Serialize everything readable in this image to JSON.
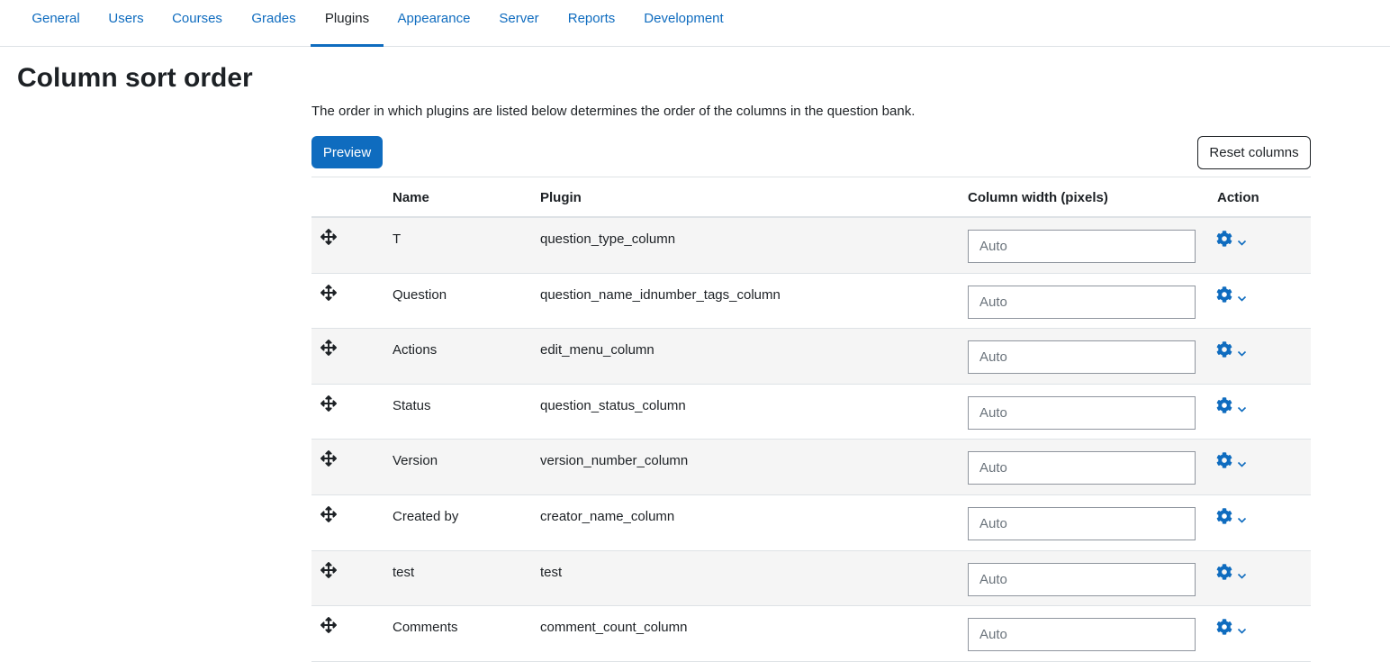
{
  "nav": {
    "tabs": [
      {
        "label": "General"
      },
      {
        "label": "Users"
      },
      {
        "label": "Courses"
      },
      {
        "label": "Grades"
      },
      {
        "label": "Plugins",
        "active": true
      },
      {
        "label": "Appearance"
      },
      {
        "label": "Server"
      },
      {
        "label": "Reports"
      },
      {
        "label": "Development"
      }
    ]
  },
  "page": {
    "title": "Column sort order",
    "intro": "The order in which plugins are listed below determines the order of the columns in the question bank."
  },
  "buttons": {
    "preview": "Preview",
    "reset": "Reset columns"
  },
  "table": {
    "headers": {
      "name": "Name",
      "plugin": "Plugin",
      "width": "Column width (pixels)",
      "action": "Action"
    },
    "rows": [
      {
        "name": "T",
        "plugin": "question_type_column",
        "width_placeholder": "Auto"
      },
      {
        "name": "Question",
        "plugin": "question_name_idnumber_tags_column",
        "width_placeholder": "Auto"
      },
      {
        "name": "Actions",
        "plugin": "edit_menu_column",
        "width_placeholder": "Auto"
      },
      {
        "name": "Status",
        "plugin": "question_status_column",
        "width_placeholder": "Auto"
      },
      {
        "name": "Version",
        "plugin": "version_number_column",
        "width_placeholder": "Auto"
      },
      {
        "name": "Created by",
        "plugin": "creator_name_column",
        "width_placeholder": "Auto"
      },
      {
        "name": "test",
        "plugin": "test",
        "width_placeholder": "Auto"
      },
      {
        "name": "Comments",
        "plugin": "comment_count_column",
        "width_placeholder": "Auto"
      }
    ]
  },
  "icons": {
    "drag": "move-icon",
    "action": "gear-icon",
    "dropdown": "chevron-down-icon"
  },
  "colors": {
    "accent": "#0f6cbf",
    "text": "#1d2125",
    "row_stripe": "#f5f5f5",
    "border": "#dee2e6"
  }
}
